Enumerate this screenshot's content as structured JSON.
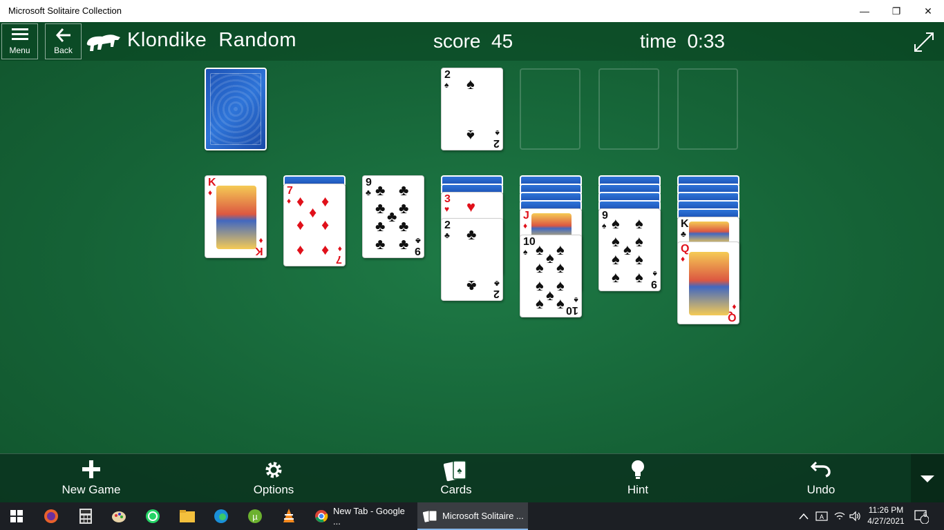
{
  "window": {
    "title": "Microsoft Solitaire Collection",
    "controls": {
      "minimize": "—",
      "maximize": "❐",
      "close": "✕"
    }
  },
  "header": {
    "menu_label": "Menu",
    "back_label": "Back",
    "game_title": "Klondike  Random",
    "score_label": "score",
    "score_value": "45",
    "time_label": "time",
    "time_value": "0:33"
  },
  "board": {
    "stock": {
      "face_down": true
    },
    "waste": [],
    "foundations": [
      {
        "rank": "2",
        "suit": "♠",
        "color": "black"
      },
      null,
      null,
      null
    ],
    "tableau": [
      {
        "hidden": 0,
        "cards": [
          {
            "rank": "K",
            "suit": "♦",
            "color": "red"
          }
        ]
      },
      {
        "hidden": 1,
        "cards": [
          {
            "rank": "7",
            "suit": "♦",
            "color": "red"
          }
        ]
      },
      {
        "hidden": 0,
        "cards": [
          {
            "rank": "9",
            "suit": "♣",
            "color": "black"
          }
        ]
      },
      {
        "hidden": 2,
        "cards": [
          {
            "rank": "3",
            "suit": "♥",
            "color": "red"
          },
          {
            "rank": "2",
            "suit": "♣",
            "color": "black"
          }
        ]
      },
      {
        "hidden": 4,
        "cards": [
          {
            "rank": "J",
            "suit": "♦",
            "color": "red"
          },
          {
            "rank": "10",
            "suit": "♠",
            "color": "black"
          }
        ]
      },
      {
        "hidden": 4,
        "cards": [
          {
            "rank": "9",
            "suit": "♠",
            "color": "black"
          }
        ]
      },
      {
        "hidden": 5,
        "cards": [
          {
            "rank": "K",
            "suit": "♣",
            "color": "black"
          },
          {
            "rank": "Q",
            "suit": "♦",
            "color": "red"
          }
        ]
      }
    ]
  },
  "commands": {
    "new_game": "New Game",
    "options": "Options",
    "cards": "Cards",
    "hint": "Hint",
    "undo": "Undo"
  },
  "taskbar": {
    "apps": [
      {
        "label": "New Tab - Google ...",
        "icon": "chrome-icon"
      },
      {
        "label": "Microsoft Solitaire ...",
        "icon": "solitaire-icon",
        "active": true
      }
    ],
    "pinned": [
      "start-icon",
      "firefox-icon",
      "calculator-icon",
      "paint-icon",
      "whatsapp-icon",
      "file-explorer-icon",
      "edge-icon",
      "utorrent-icon",
      "vlc-icon"
    ],
    "clock_time": "11:26 PM",
    "clock_date": "4/27/2021",
    "notification_count": "6"
  },
  "colors": {
    "felt": "#156236",
    "red_suit": "#e0101a",
    "black_suit": "#111111",
    "card_back": "#1d52b5"
  }
}
